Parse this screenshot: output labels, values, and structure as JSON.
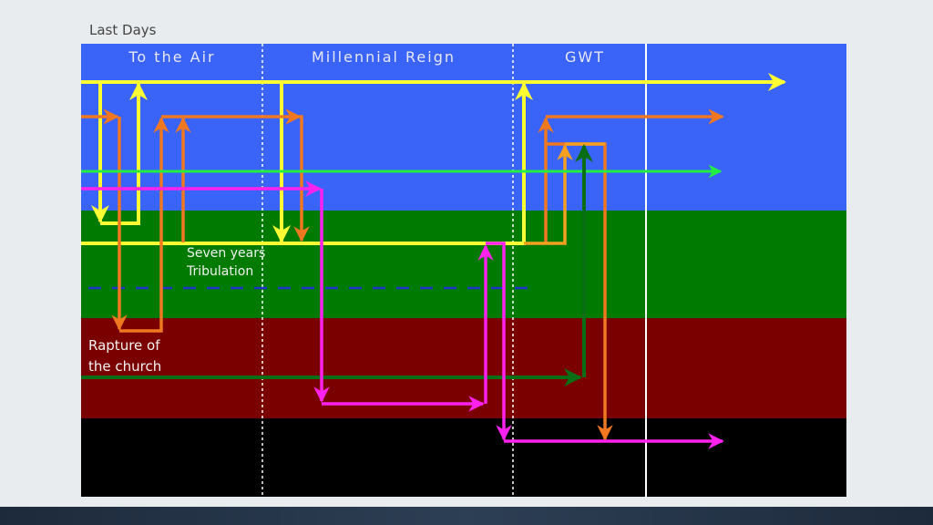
{
  "slide": {
    "title": "Last Days"
  },
  "diagram": {
    "column_labels": [
      "To the Air",
      "Millennial Reign",
      "GWT"
    ],
    "annotations": {
      "tribulation_line1": "Seven years",
      "tribulation_line2": "Tribulation",
      "rapture_line1": "Rapture of",
      "rapture_line2": "the church"
    },
    "colors": {
      "heaven_band": "#3a63f8",
      "earth_band": "#007a00",
      "hades_band": "#7a0000",
      "lake_band": "#000000",
      "yellow": "#ffff33",
      "orange": "#f07820",
      "light_orange": "#f5a020",
      "green": "#22ee44",
      "dark_green": "#0a6e14",
      "magenta": "#ff22ee",
      "divider_dashed_blue": "#2233cc"
    }
  }
}
